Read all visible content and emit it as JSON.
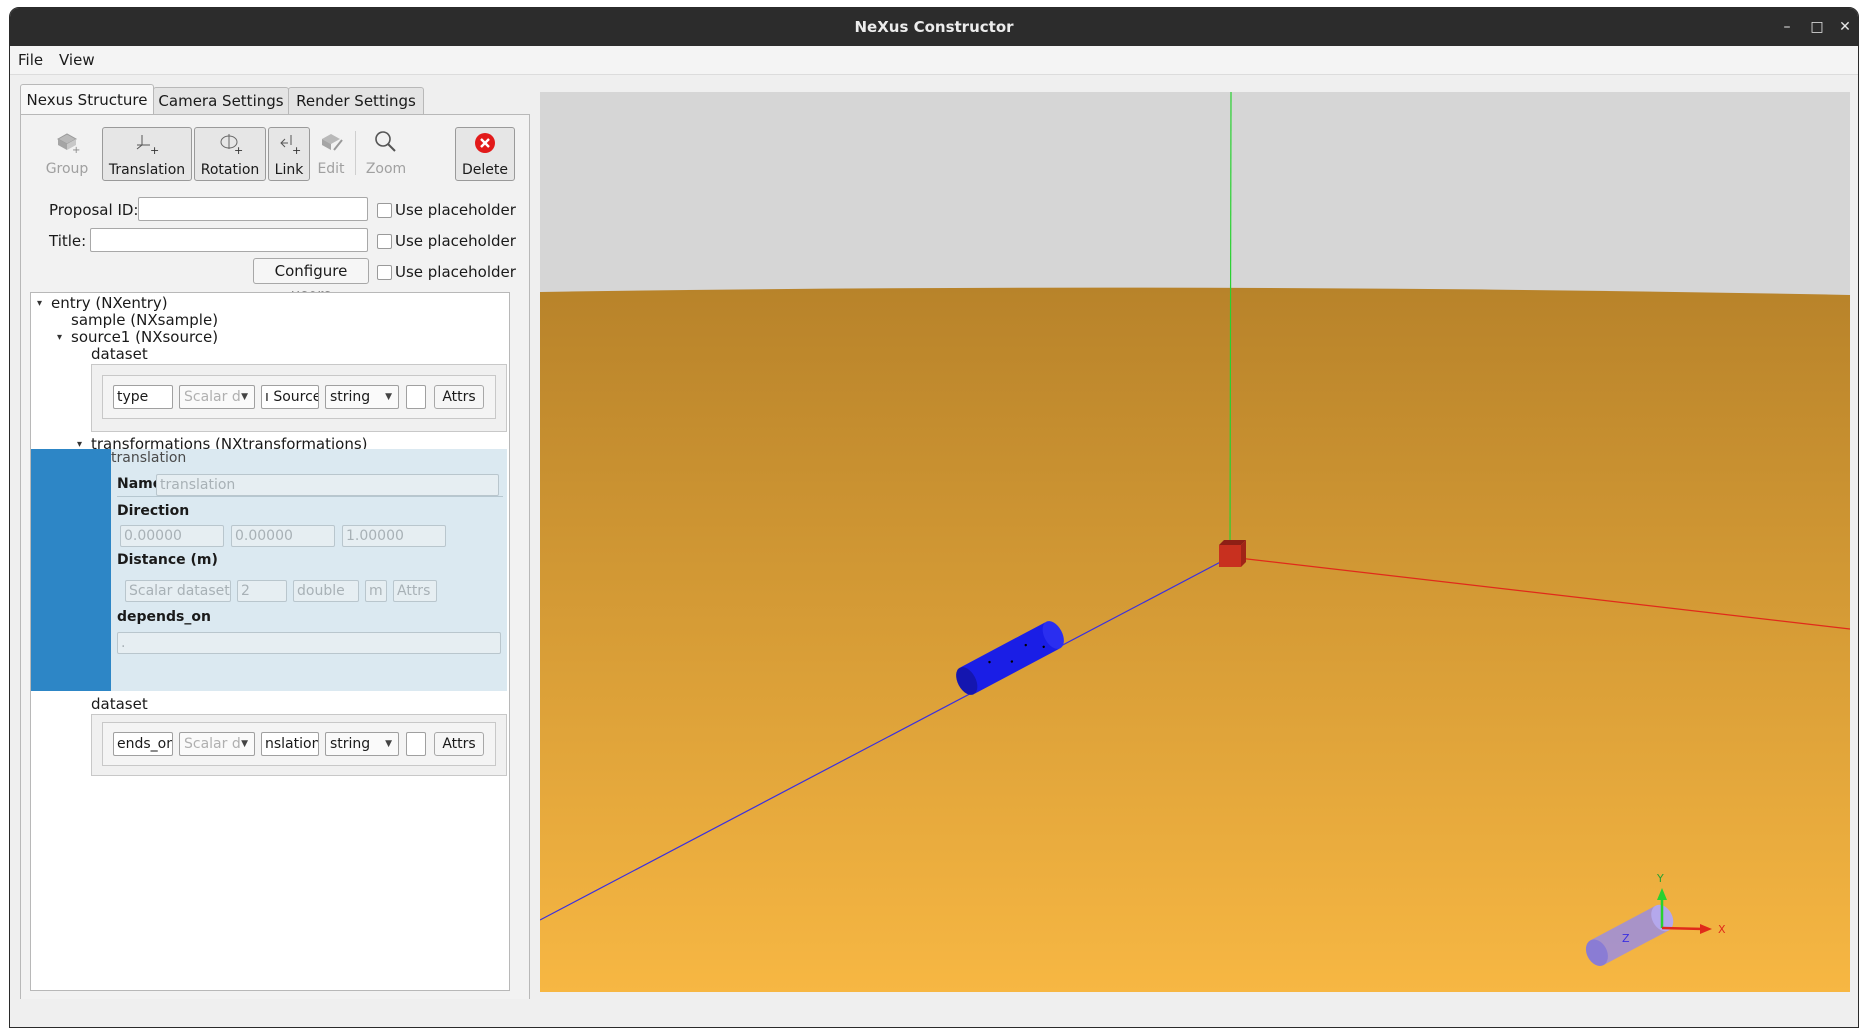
{
  "window": {
    "title": "NeXus Constructor",
    "controls": {
      "minimize": "–",
      "maximize": "□",
      "close": "✕"
    }
  },
  "menu": {
    "file": "File",
    "view": "View"
  },
  "tabs": [
    {
      "label": "Nexus Structure"
    },
    {
      "label": "Camera Settings"
    },
    {
      "label": "Render Settings"
    }
  ],
  "toolbar": {
    "group": "Group",
    "translation": "Translation",
    "rotation": "Rotation",
    "link": "Link",
    "edit": "Edit",
    "zoom": "Zoom",
    "delete": "Delete"
  },
  "form": {
    "proposal_label": "Proposal ID:",
    "proposal_value": "",
    "title_label": "Title:",
    "title_value": "",
    "configure_users": "Configure users",
    "use_placeholder": "Use placeholder"
  },
  "tree": {
    "entry": "entry (NXentry)",
    "sample": "sample (NXsample)",
    "source": "source1 (NXsource)",
    "dataset1": {
      "label": "dataset",
      "name": "type",
      "kind": "Scalar d",
      "value": "ı Source",
      "dtype": "string",
      "attrs": "Attrs"
    },
    "transformations": "transformations (NXtransformations)",
    "translation": {
      "header": "translation",
      "name_label": "Name",
      "name_placeholder": "translation",
      "direction_label": "Direction",
      "direction": [
        "0.00000",
        "0.00000",
        "1.00000"
      ],
      "distance_label": "Distance (m)",
      "distance_kind": "Scalar dataset",
      "distance_value": "2",
      "distance_dtype": "double",
      "distance_unit": "m",
      "distance_attrs": "Attrs",
      "depends_on_label": "depends_on",
      "depends_on_value": "."
    },
    "dataset2": {
      "label": "dataset",
      "name": "ends_on",
      "kind": "Scalar d",
      "value": "nslation",
      "dtype": "string",
      "attrs": "Attrs"
    }
  },
  "viewport": {
    "sky_color": "#d6d6d6",
    "ground_top": "#b8832a",
    "ground_bottom": "#f7b743",
    "axis_x": "#e02a1a",
    "axis_y": "#29d130",
    "axis_z": "#3a2fe0",
    "sample_color": "#c8301f",
    "source_color": "#1a1ee6",
    "gizmo": {
      "x": "X",
      "y": "Y",
      "z": "Z"
    }
  }
}
